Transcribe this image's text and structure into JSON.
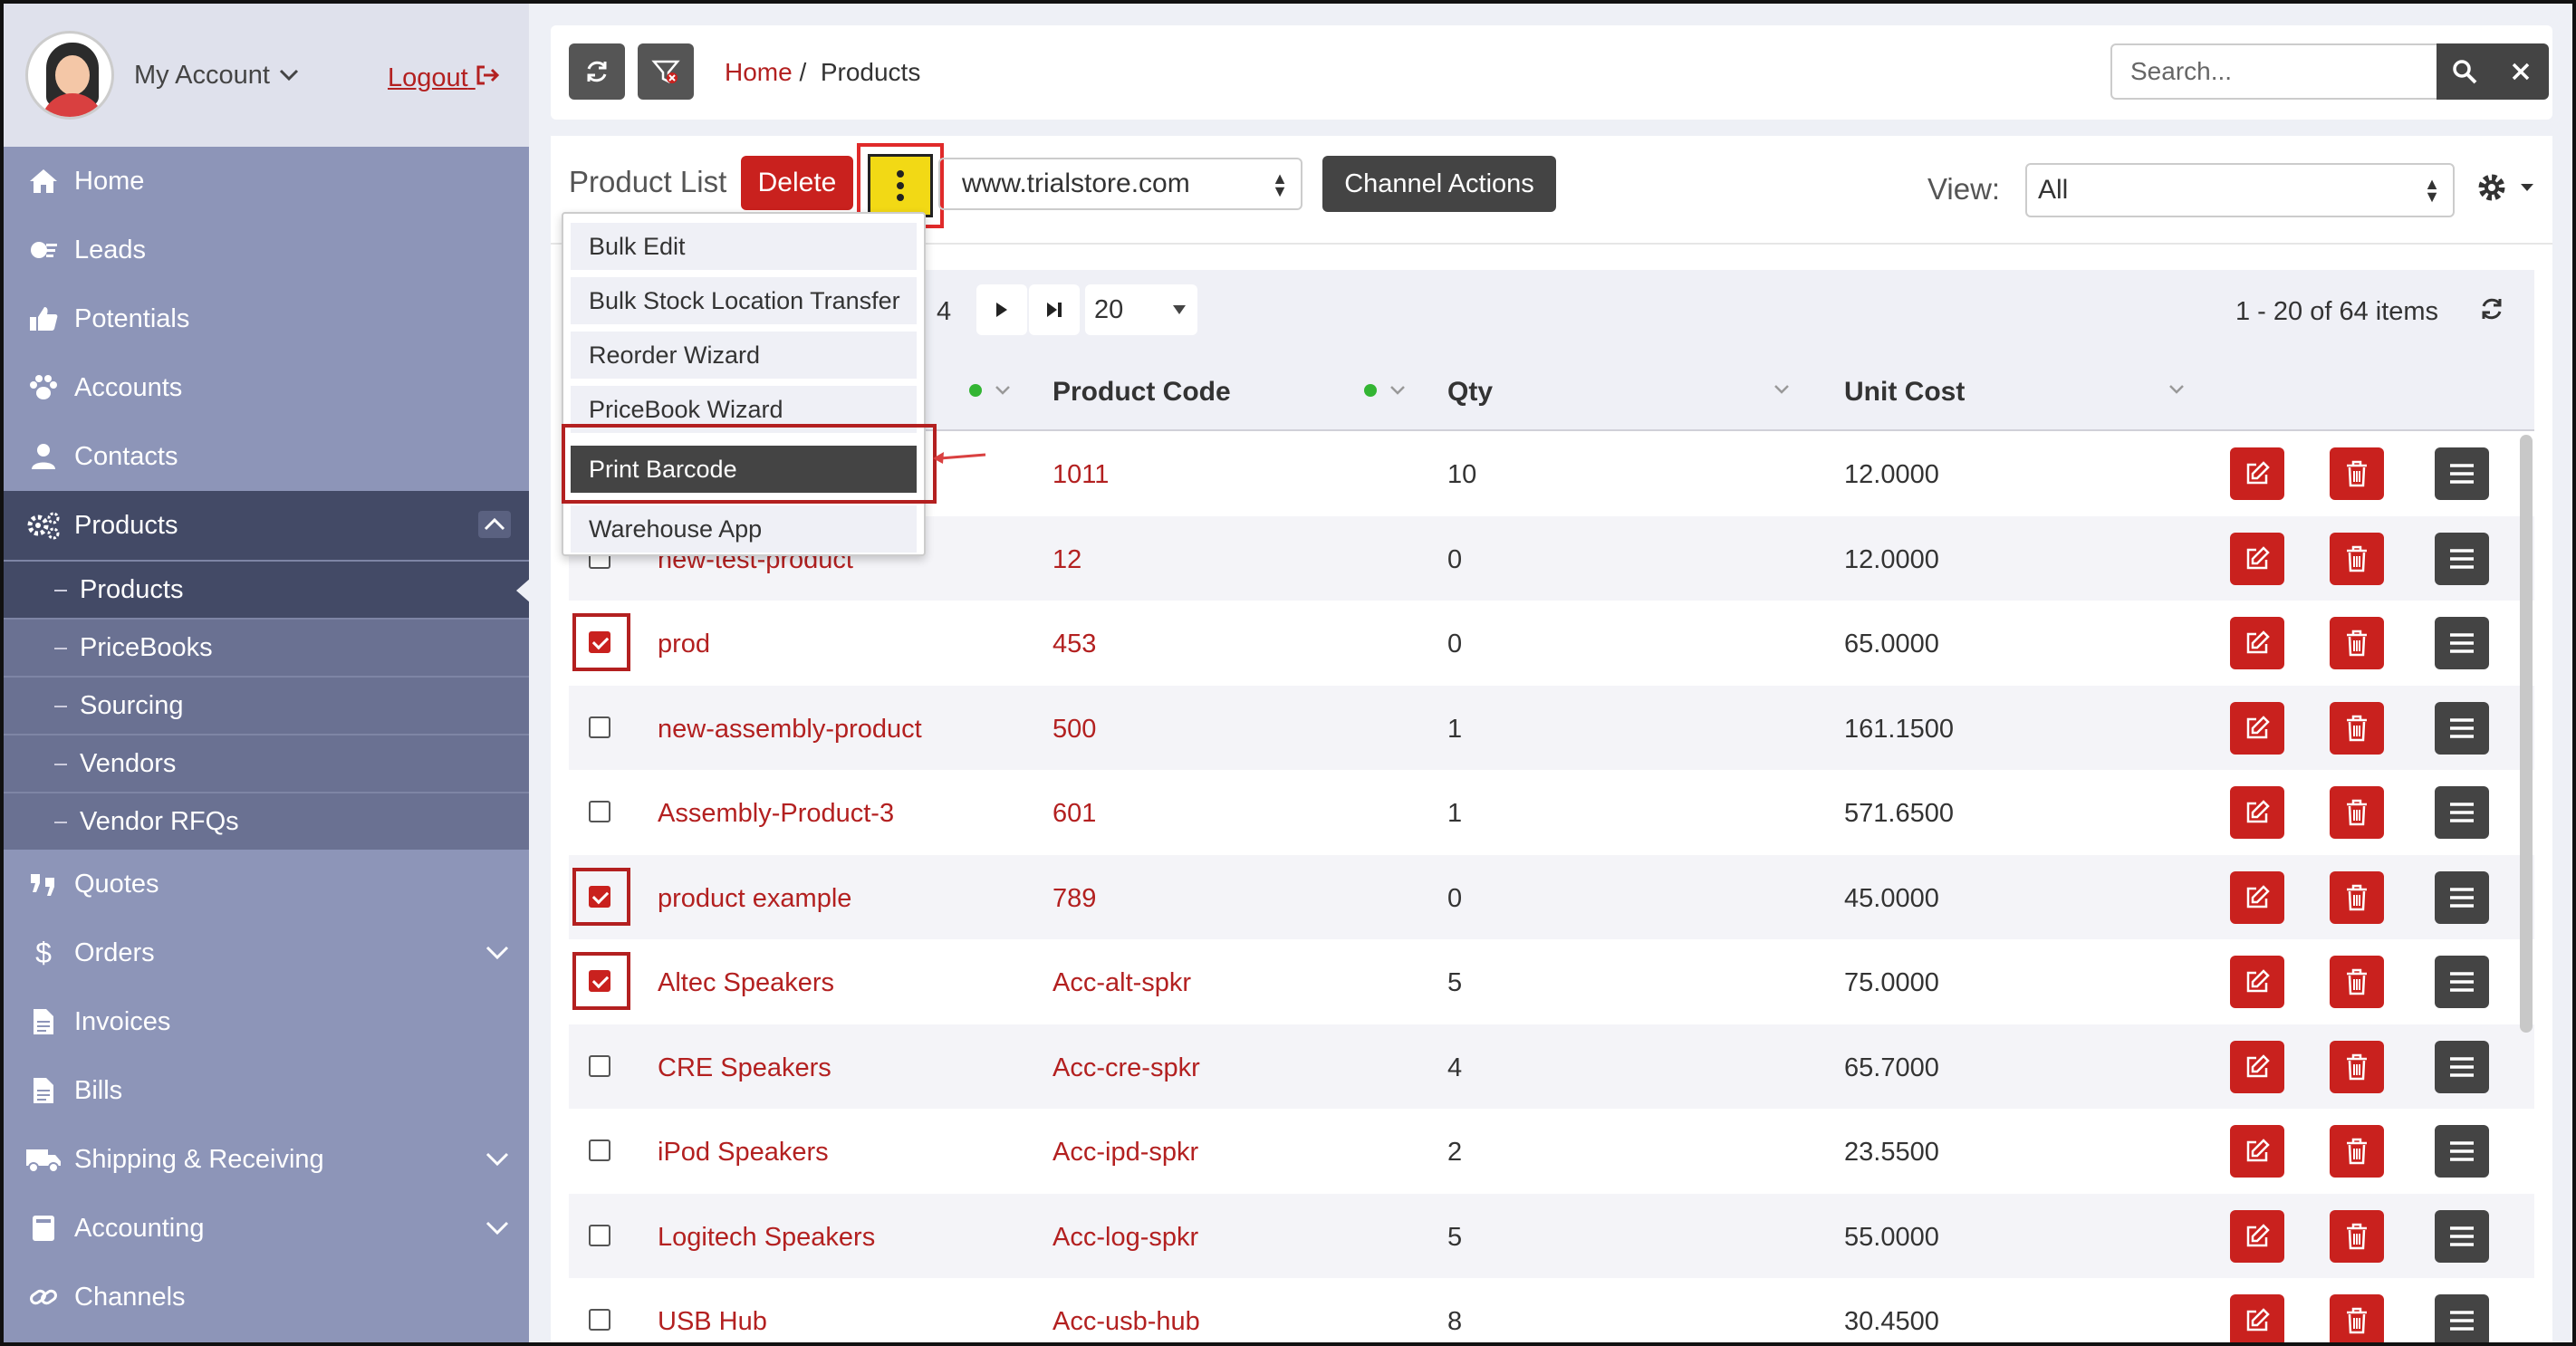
{
  "sidebar": {
    "account_label": "My Account",
    "logout_label": "Logout",
    "items": [
      {
        "label": "Home",
        "icon": "home-icon"
      },
      {
        "label": "Leads",
        "icon": "leads-icon"
      },
      {
        "label": "Potentials",
        "icon": "thumbs-up-icon"
      },
      {
        "label": "Accounts",
        "icon": "paw-icon"
      },
      {
        "label": "Contacts",
        "icon": "user-icon"
      },
      {
        "label": "Products",
        "icon": "cogs-icon"
      }
    ],
    "products_sub": [
      "Products",
      "PriceBooks",
      "Sourcing",
      "Vendors",
      "Vendor RFQs"
    ],
    "items_after": [
      {
        "label": "Quotes",
        "icon": "quote-icon"
      },
      {
        "label": "Orders",
        "icon": "dollar-icon"
      },
      {
        "label": "Invoices",
        "icon": "file-icon"
      },
      {
        "label": "Bills",
        "icon": "file-icon"
      },
      {
        "label": "Shipping & Receiving",
        "icon": "truck-icon"
      },
      {
        "label": "Accounting",
        "icon": "book-icon"
      },
      {
        "label": "Channels",
        "icon": "link-icon"
      }
    ]
  },
  "breadcrumb": {
    "home": "Home",
    "separator": "/",
    "current": "Products"
  },
  "search": {
    "placeholder": "Search..."
  },
  "toolbar": {
    "title": "Product List",
    "delete_label": "Delete",
    "store_value": "www.trialstore.com",
    "channel_actions_label": "Channel Actions",
    "view_label": "View:",
    "view_value": "All"
  },
  "dropdown": {
    "items": [
      "Bulk Edit",
      "Bulk Stock Location Transfer",
      "Reorder Wizard",
      "PriceBook Wizard",
      "Print Barcode",
      "Warehouse App"
    ],
    "selected": "Print Barcode"
  },
  "pager": {
    "page_fragment": "4",
    "page_size": "20",
    "info": "1 - 20 of 64 items"
  },
  "table": {
    "columns": [
      "Product Code",
      "Qty",
      "Unit Cost"
    ],
    "rows": [
      {
        "name": "",
        "code": "1011",
        "qty": "10",
        "cost": "12.0000",
        "checked": false
      },
      {
        "name": "new-test-product",
        "code": "12",
        "qty": "0",
        "cost": "12.0000",
        "checked": false
      },
      {
        "name": "prod",
        "code": "453",
        "qty": "0",
        "cost": "65.0000",
        "checked": true
      },
      {
        "name": "new-assembly-product",
        "code": "500",
        "qty": "1",
        "cost": "161.1500",
        "checked": false
      },
      {
        "name": "Assembly-Product-3",
        "code": "601",
        "qty": "1",
        "cost": "571.6500",
        "checked": false
      },
      {
        "name": "product example",
        "code": "789",
        "qty": "0",
        "cost": "45.0000",
        "checked": true
      },
      {
        "name": "Altec Speakers",
        "code": "Acc-alt-spkr",
        "qty": "5",
        "cost": "75.0000",
        "checked": true
      },
      {
        "name": "CRE Speakers",
        "code": "Acc-cre-spkr",
        "qty": "4",
        "cost": "65.7000",
        "checked": false
      },
      {
        "name": "iPod Speakers",
        "code": "Acc-ipd-spkr",
        "qty": "2",
        "cost": "23.5500",
        "checked": false
      },
      {
        "name": "Logitech Speakers",
        "code": "Acc-log-spkr",
        "qty": "5",
        "cost": "55.0000",
        "checked": false
      },
      {
        "name": "USB Hub",
        "code": "Acc-usb-hub",
        "qty": "8",
        "cost": "30.4500",
        "checked": false
      }
    ]
  },
  "colors": {
    "accent": "#c9211e",
    "sidebar": "#8d95b8",
    "sidebar_active": "#434a66",
    "highlight": "#f2d915"
  }
}
